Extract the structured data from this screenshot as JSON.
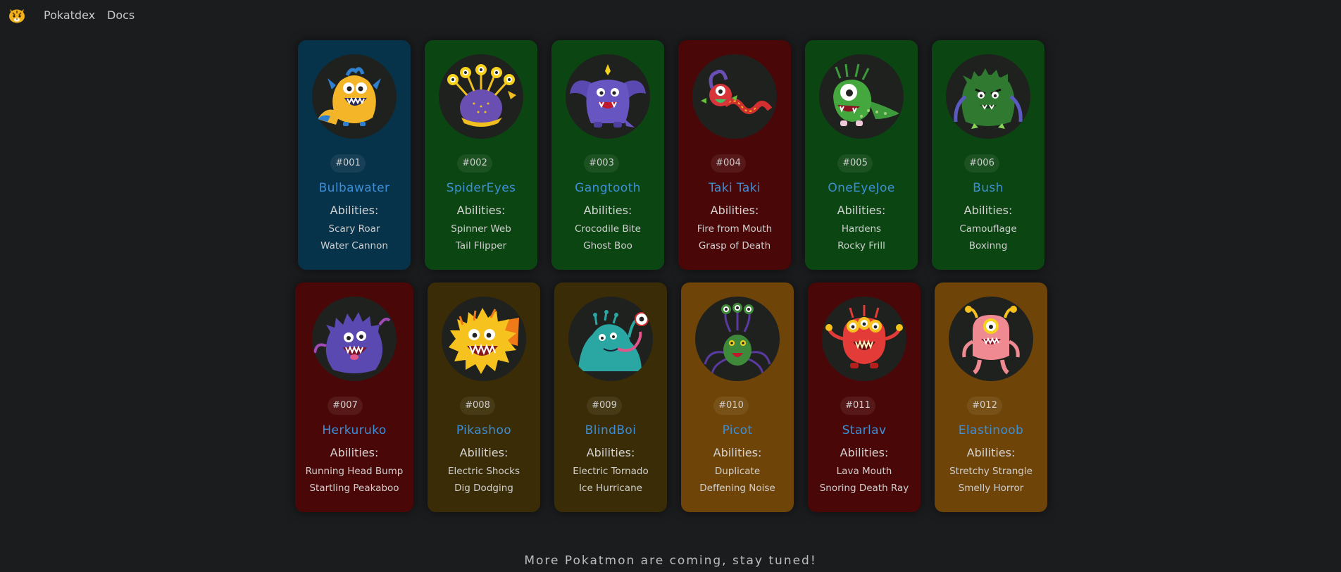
{
  "nav": {
    "logo_icon": "tiger-face-icon",
    "links": [
      "Pokatdex",
      "Docs"
    ]
  },
  "colors": {
    "background": "#1b1c1e",
    "name_text": "#3d8fd8",
    "card_blue": "#06324a",
    "card_green": "#0b4512",
    "card_red": "#4a0707",
    "card_olive": "#3a2c06",
    "card_orange": "#6e4408"
  },
  "cards": [
    {
      "number": "#001",
      "name": "Bulbawater",
      "abilities_title": "Abilities:",
      "abilities": [
        "Scary Roar",
        "Water Cannon"
      ],
      "color": "blue",
      "icon": "yellow-blue-monster-icon"
    },
    {
      "number": "#002",
      "name": "SpiderEyes",
      "abilities_title": "Abilities:",
      "abilities": [
        "Spinner Web",
        "Tail Flipper"
      ],
      "color": "green",
      "icon": "many-eyed-purple-monster-icon"
    },
    {
      "number": "#003",
      "name": "Gangtooth",
      "abilities_title": "Abilities:",
      "abilities": [
        "Crocodile Bite",
        "Ghost Boo"
      ],
      "color": "green",
      "icon": "winged-purple-monster-icon"
    },
    {
      "number": "#004",
      "name": "Taki Taki",
      "abilities_title": "Abilities:",
      "abilities": [
        "Fire from Mouth",
        "Grasp of Death"
      ],
      "color": "red",
      "icon": "red-serpent-monster-icon"
    },
    {
      "number": "#005",
      "name": "OneEyeJoe",
      "abilities_title": "Abilities:",
      "abilities": [
        "Hardens",
        "Rocky Frill"
      ],
      "color": "green",
      "icon": "green-one-eyed-lizard-icon"
    },
    {
      "number": "#006",
      "name": "Bush",
      "abilities_title": "Abilities:",
      "abilities": [
        "Camouflage",
        "Boxinng"
      ],
      "color": "green",
      "icon": "furry-green-monster-icon"
    },
    {
      "number": "#007",
      "name": "Herkuruko",
      "abilities_title": "Abilities:",
      "abilities": [
        "Running Head Bump",
        "Startling Peakaboo"
      ],
      "color": "red",
      "icon": "furry-purple-monster-icon"
    },
    {
      "number": "#008",
      "name": "Pikashoo",
      "abilities_title": "Abilities:",
      "abilities": [
        "Electric Shocks",
        "Dig Dodging"
      ],
      "color": "olive",
      "icon": "yellow-fluffy-monster-icon"
    },
    {
      "number": "#009",
      "name": "BlindBoi",
      "abilities_title": "Abilities:",
      "abilities": [
        "Electric Tornado",
        "Ice Hurricane"
      ],
      "color": "olive",
      "icon": "teal-furry-monster-icon"
    },
    {
      "number": "#010",
      "name": "Picot",
      "abilities_title": "Abilities:",
      "abilities": [
        "Duplicate",
        "Deffening Noise"
      ],
      "color": "orange",
      "icon": "green-spider-monster-icon"
    },
    {
      "number": "#011",
      "name": "Starlav",
      "abilities_title": "Abilities:",
      "abilities": [
        "Lava Mouth",
        "Snoring Death Ray"
      ],
      "color": "red",
      "icon": "red-three-eyed-monster-icon"
    },
    {
      "number": "#012",
      "name": "Elastinoob",
      "abilities_title": "Abilities:",
      "abilities": [
        "Stretchy Strangle",
        "Smelly Horror"
      ],
      "color": "orange",
      "icon": "pink-one-eyed-monster-icon"
    }
  ],
  "footer": "More Pokatmon are coming, stay tuned!"
}
